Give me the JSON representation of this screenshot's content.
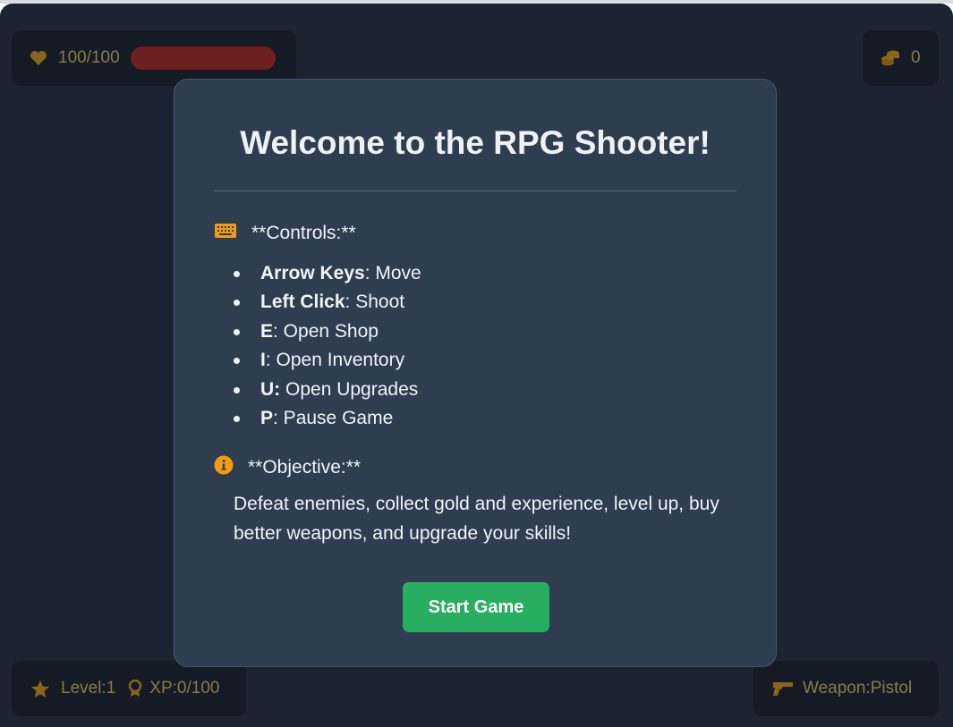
{
  "hud": {
    "health_text": "100/100",
    "health_fraction": 1.0,
    "gold_text": "0",
    "level_text": "Level:1",
    "xp_text": "XP:0/100",
    "weapon_text": "Weapon:Pistol"
  },
  "modal": {
    "title": "Welcome to the RPG Shooter!",
    "controls_heading": "**Controls:**",
    "controls": [
      {
        "key": "Arrow Keys",
        "action": ": Move"
      },
      {
        "key": "Left Click",
        "action": ": Shoot"
      },
      {
        "key": "E",
        "action": ": Open Shop"
      },
      {
        "key": "I",
        "action": ": Open Inventory"
      },
      {
        "key": "U:",
        "action": " Open Upgrades"
      },
      {
        "key": "P",
        "action": ": Pause Game"
      }
    ],
    "objective_heading": "**Objective:**",
    "objective_text": "Defeat enemies, collect gold and experience, level up, buy better weapons, and upgrade your skills!",
    "start_label": "Start Game"
  },
  "icons": {
    "health": "heart-icon",
    "gold": "coins-icon",
    "level": "star-icon",
    "xp": "award-icon",
    "weapon": "gun-icon",
    "controls": "keyboard-icon",
    "objective": "info-icon"
  },
  "colors": {
    "accent_orange": "#f39c12",
    "start_green": "#27ae60",
    "health_red": "#6e1f1f",
    "modal_bg": "#2e3d50",
    "game_bg": "#1b2430"
  }
}
